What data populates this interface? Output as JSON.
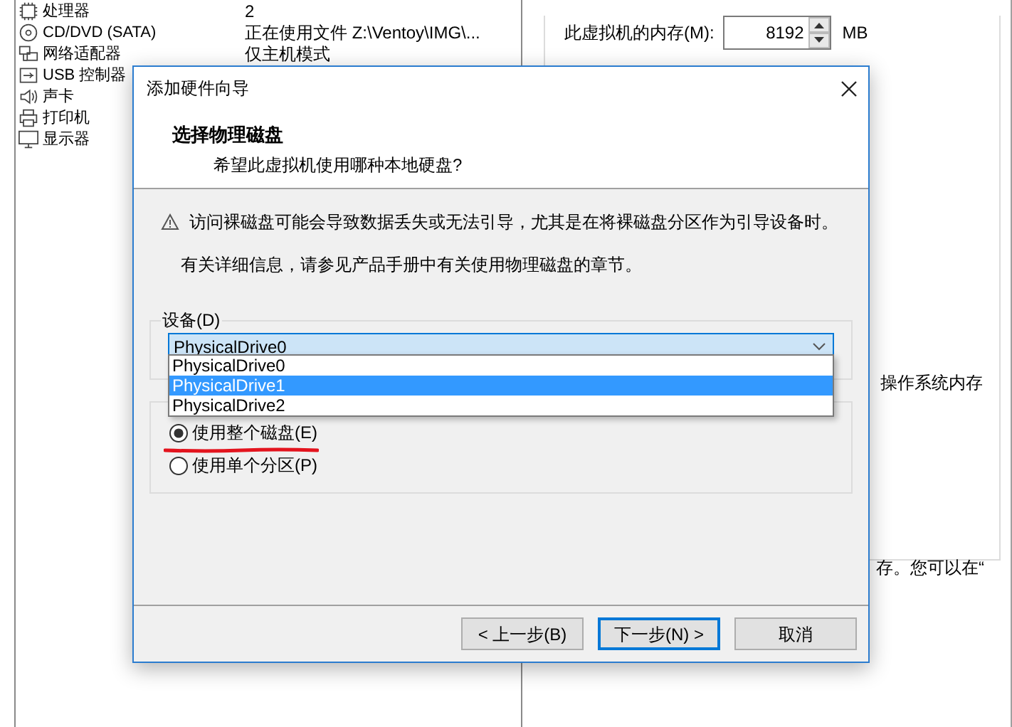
{
  "hardware_list": [
    {
      "device": "处理器",
      "summary": "2",
      "kind": "cpu"
    },
    {
      "device": "CD/DVD (SATA)",
      "summary": "正在使用文件 Z:\\Ventoy\\IMG\\...",
      "kind": "disc"
    },
    {
      "device": "网络适配器",
      "summary": "仅主机模式",
      "kind": "network"
    },
    {
      "device": "USB 控制器",
      "kind": "usb"
    },
    {
      "device": "声卡",
      "kind": "sound"
    },
    {
      "device": "打印机",
      "kind": "printer"
    },
    {
      "device": "显示器",
      "kind": "monitor"
    }
  ],
  "memory": {
    "label": "此虚拟机的内存(M):",
    "value": "8192",
    "unit": "MB"
  },
  "right_panel_texts": [
    "操作系统内存",
    "存。您可以在“"
  ],
  "dialog": {
    "title": "添加硬件向导",
    "heading": "选择物理磁盘",
    "subtitle": "希望此虚拟机使用哪种本地硬盘?",
    "warning": "访问裸磁盘可能会导致数据丢失或无法引导，尤其是在将裸磁盘分区作为引导设备时。",
    "info": "有关详细信息，请参见产品手册中有关使用物理磁盘的章节。",
    "device_group": {
      "label": "设备(D)",
      "value": "PhysicalDrive0",
      "expanded": true,
      "options": [
        {
          "label": "PhysicalDrive0",
          "highlighted": false
        },
        {
          "label": "PhysicalDrive1",
          "highlighted": true
        },
        {
          "label": "PhysicalDrive2",
          "highlighted": false
        }
      ]
    },
    "usage_radios": [
      {
        "label": "使用整个磁盘(E)",
        "selected": true
      },
      {
        "label": "使用单个分区(P)",
        "selected": false
      }
    ],
    "buttons": [
      {
        "label": "< 上一步(B)",
        "default": false
      },
      {
        "label": "下一步(N) >",
        "default": true
      },
      {
        "label": "取消",
        "default": false
      }
    ]
  }
}
